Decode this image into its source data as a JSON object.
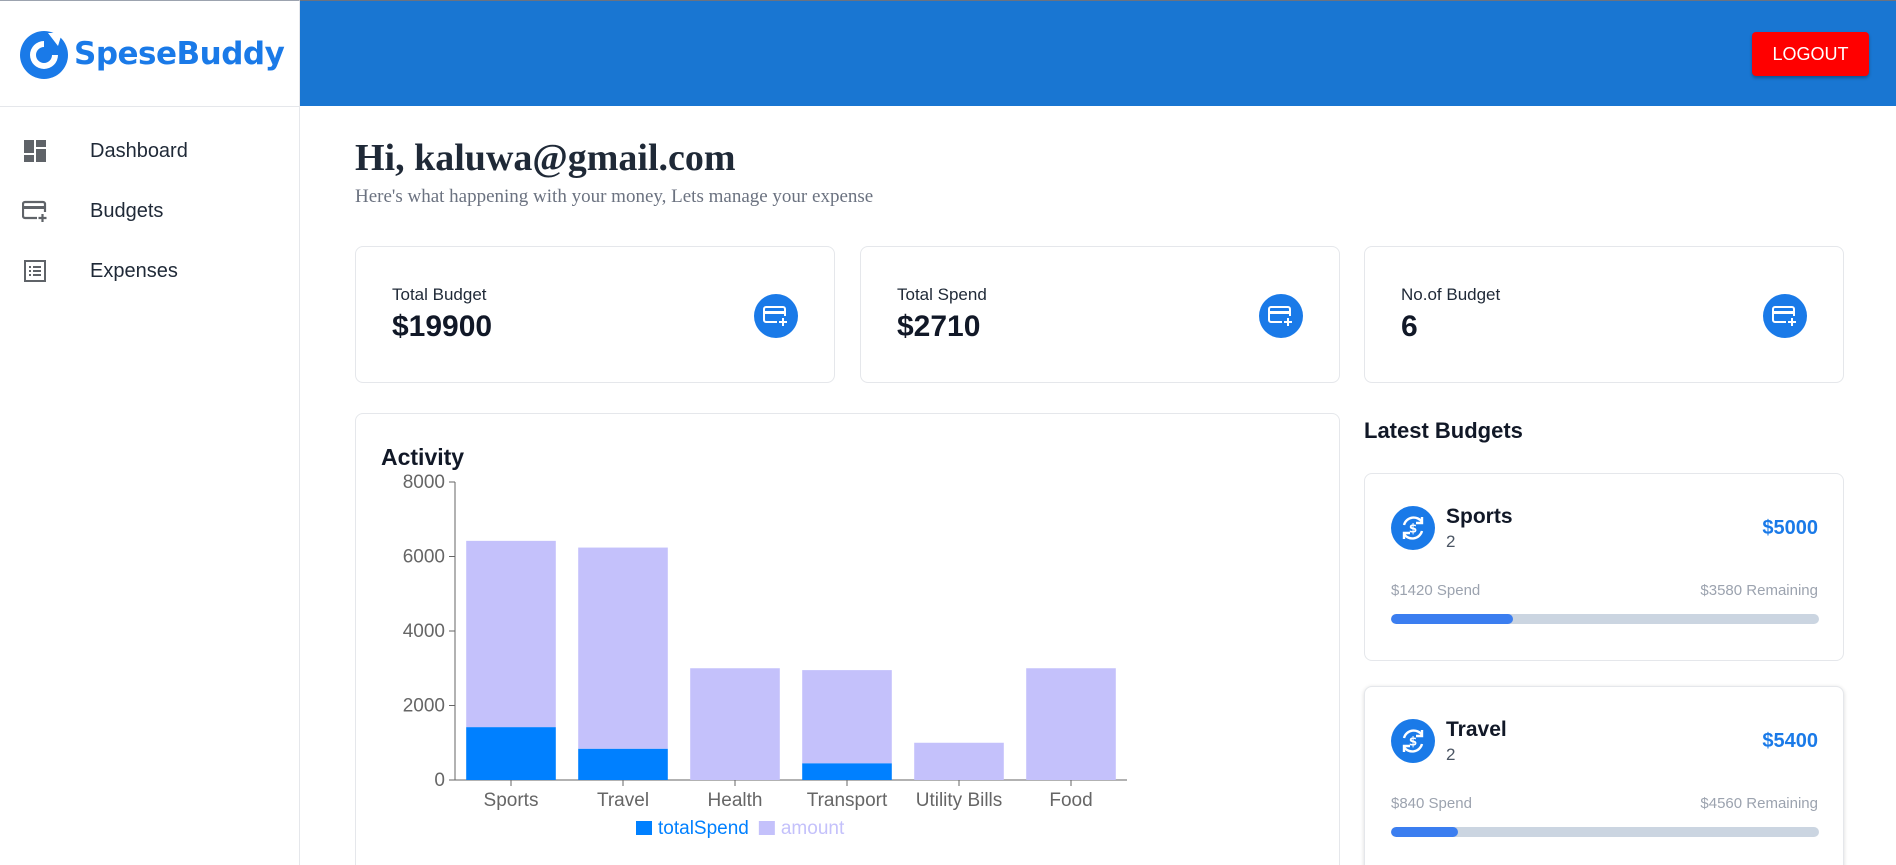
{
  "app": {
    "name": "SpeseBuddy"
  },
  "sidebar": {
    "items": [
      {
        "label": "Dashboard",
        "icon": "dashboard-icon"
      },
      {
        "label": "Budgets",
        "icon": "budget-card-icon"
      },
      {
        "label": "Expenses",
        "icon": "list-icon"
      }
    ]
  },
  "header": {
    "logout_label": "LOGOUT"
  },
  "greeting": {
    "title": "Hi, kaluwa@gmail.com",
    "subtitle": "Here's what happening with your money, Lets manage your expense"
  },
  "stats": [
    {
      "label": "Total Budget",
      "value": "$19900",
      "icon": "credit-card-add-icon"
    },
    {
      "label": "Total Spend",
      "value": "$2710",
      "icon": "credit-card-add-icon"
    },
    {
      "label": "No.of Budget",
      "value": "6",
      "icon": "credit-card-add-icon"
    }
  ],
  "activity": {
    "title": "Activity"
  },
  "chart_data": {
    "type": "bar",
    "stacked": true,
    "categories": [
      "Sports",
      "Travel",
      "Health",
      "Transport",
      "Utility Bills",
      "Food"
    ],
    "series": [
      {
        "name": "totalSpend",
        "values": [
          1420,
          840,
          0,
          450,
          0,
          0
        ],
        "color": "#0080ff"
      },
      {
        "name": "amount",
        "values": [
          5000,
          5400,
          3000,
          2500,
          1000,
          3000
        ],
        "color": "#c4c1fb"
      }
    ],
    "yticks": [
      "0",
      "2000",
      "4000",
      "6000",
      "8000"
    ],
    "ylim": [
      0,
      8000
    ],
    "legend": "bottom"
  },
  "latest": {
    "title": "Latest Budgets",
    "budgets": [
      {
        "name": "Sports",
        "count": "2",
        "amount": "$5000",
        "spend": "$1420 Spend",
        "remaining": "$3580 Remaining",
        "progress": 0.284
      },
      {
        "name": "Travel",
        "count": "2",
        "amount": "$5400",
        "spend": "$840 Spend",
        "remaining": "$4560 Remaining",
        "progress": 0.156
      }
    ]
  },
  "colors": {
    "primary": "#1a7ae8",
    "header": "#1976d2",
    "logout": "#ff0000"
  }
}
